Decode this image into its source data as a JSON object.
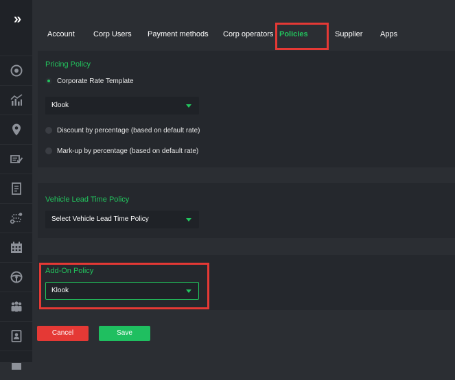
{
  "sidebar": {
    "expand_icon": "»",
    "items": [
      {
        "icon": "target-icon"
      },
      {
        "icon": "chart-icon"
      },
      {
        "icon": "location-pin-icon"
      },
      {
        "icon": "checklist-icon"
      },
      {
        "icon": "document-icon"
      },
      {
        "icon": "route-icon"
      },
      {
        "icon": "calendar-icon"
      },
      {
        "icon": "steering-wheel-icon"
      },
      {
        "icon": "users-icon"
      },
      {
        "icon": "contact-card-icon"
      }
    ]
  },
  "tabs": [
    {
      "label": "Account"
    },
    {
      "label": "Corp Users"
    },
    {
      "label": "Payment methods"
    },
    {
      "label": "Corp operators"
    },
    {
      "label": "Policies"
    },
    {
      "label": "Supplier"
    },
    {
      "label": "Apps"
    }
  ],
  "pricing": {
    "title": "Pricing Policy",
    "option1": "Corporate Rate Template",
    "template_value": "Klook",
    "option2": "Discount by percentage (based on default rate)",
    "option3": "Mark-up by percentage (based on default rate)"
  },
  "vehicle": {
    "title": "Vehicle Lead Time Policy",
    "value": "Select Vehicle Lead Time Policy"
  },
  "addon": {
    "title": "Add-On Policy",
    "value": "Klook"
  },
  "actions": {
    "cancel": "Cancel",
    "save": "Save"
  },
  "colors": {
    "accent": "#22c55e",
    "cancel": "#e53935",
    "highlight": "#e53935"
  }
}
